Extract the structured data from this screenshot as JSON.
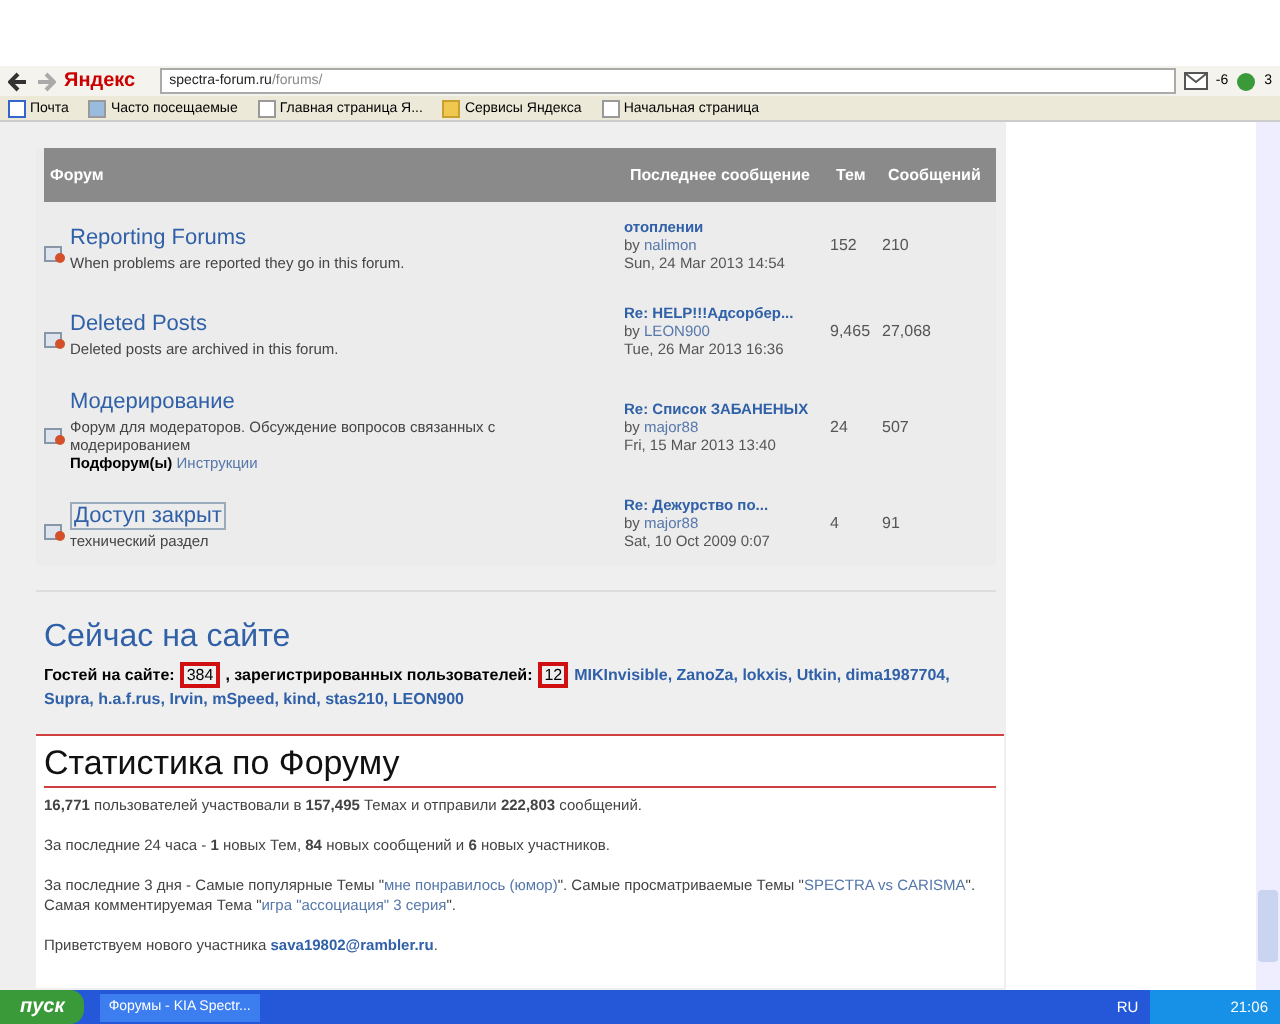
{
  "browser": {
    "brand": "Яндекс",
    "url_host": "spectra-forum.ru",
    "url_path": "/forums/",
    "weather": "-6",
    "mail_count": "3",
    "bookmarks": [
      {
        "label": "Почта",
        "kind": "mail"
      },
      {
        "label": "Часто посещаемые",
        "kind": "star"
      },
      {
        "label": "Главная страница Я...",
        "kind": "page"
      },
      {
        "label": "Сервисы Яндекса",
        "kind": "folder"
      },
      {
        "label": "Начальная страница",
        "kind": "page"
      }
    ]
  },
  "table": {
    "columns": [
      "Форум",
      "Последнее сообщение",
      "Тем",
      "Сообщений"
    ],
    "rows": [
      {
        "title": "Reporting Forums",
        "focused": false,
        "description": "When problems are reported they go in this forum.",
        "last_post": "отоплении",
        "by": "by",
        "author": "nalimon",
        "date": "Sun, 24 Mar 2013 14:54",
        "topics": "152",
        "posts": "210"
      },
      {
        "title": "Deleted Posts",
        "focused": false,
        "description": "Deleted posts are archived in this forum.",
        "last_post": "Re: HELP!!!Адсорбер...",
        "by": "by",
        "author": "LEON900",
        "date": "Tue, 26 Mar 2013 16:36",
        "topics": "9,465",
        "posts": "27,068"
      },
      {
        "title": "Модерирование",
        "focused": false,
        "description": "Форум для модераторов. Обсуждение вопросов связанных с модерированием",
        "subforums_label": "Подфорум(ы)",
        "subforums": "Инструкции",
        "last_post": "Re: Список ЗАБАНЕНЫХ",
        "by": "by",
        "author": "major88",
        "date": "Fri, 15 Mar 2013 13:40",
        "topics": "24",
        "posts": "507"
      },
      {
        "title": "Доступ закрыт",
        "focused": true,
        "description": "технический раздел",
        "last_post": "Re: Дежурство по...",
        "by": "by",
        "author": "major88",
        "date": "Sat, 10 Oct 2009 0:07",
        "topics": "4",
        "posts": "91"
      }
    ]
  },
  "online": {
    "title": "Сейчас на сайте",
    "guests_label": "Гостей на сайте:",
    "guests": "384",
    "guests_highlighted": true,
    "users_label": ", зарегистрированных пользователей:",
    "users": "12",
    "users_highlighted": true,
    "names": [
      "MIKInvisible,",
      "ZanoZa,",
      "lokxis,",
      "Utkin,",
      "dima1987704,",
      "Supra,",
      "h.a.f.rus,",
      "Irvin,",
      "mSpeed,",
      "kind,",
      "stas210,",
      "LEON900"
    ]
  },
  "stats": {
    "title": "Статистика по Форуму",
    "paragraphs": [
      [
        {
          "kind": "bold",
          "text": "16,771"
        },
        {
          "kind": "text",
          "text": " пользователей участвовали в "
        },
        {
          "kind": "bold",
          "text": "157,495"
        },
        {
          "kind": "text",
          "text": " Темах и отправили "
        },
        {
          "kind": "bold",
          "text": "222,803"
        },
        {
          "kind": "text",
          "text": " сообщений."
        }
      ],
      [
        {
          "kind": "text",
          "text": "За последние 24 часа - "
        },
        {
          "kind": "bold",
          "text": "1"
        },
        {
          "kind": "text",
          "text": " новых Тем, "
        },
        {
          "kind": "bold",
          "text": "84"
        },
        {
          "kind": "text",
          "text": " новых сообщений и "
        },
        {
          "kind": "bold",
          "text": "6"
        },
        {
          "kind": "text",
          "text": " новых участников."
        }
      ],
      [
        {
          "kind": "text",
          "text": "За последние 3 дня - Самые популярные Темы \""
        },
        {
          "kind": "link",
          "text": "мне понравилось (юмор)"
        },
        {
          "kind": "text",
          "text": "\". Самые просматриваемые Темы \""
        },
        {
          "kind": "link",
          "text": "SPECTRA vs CARISMA"
        },
        {
          "kind": "text",
          "text": "\". Самая комментируемая Тема \""
        },
        {
          "kind": "link",
          "text": "игра \"ассоциация\" 3 серия"
        },
        {
          "kind": "text",
          "text": "\"."
        }
      ],
      [
        {
          "kind": "text",
          "text": "Приветствуем нового участника "
        },
        {
          "kind": "boldlink",
          "text": "sava19802@rambler.ru"
        },
        {
          "kind": "text",
          "text": "."
        }
      ]
    ]
  },
  "taskbar": {
    "start": "пуск",
    "task": "Форумы - KIA Spectr...",
    "language": "RU",
    "clock": "21:06"
  }
}
